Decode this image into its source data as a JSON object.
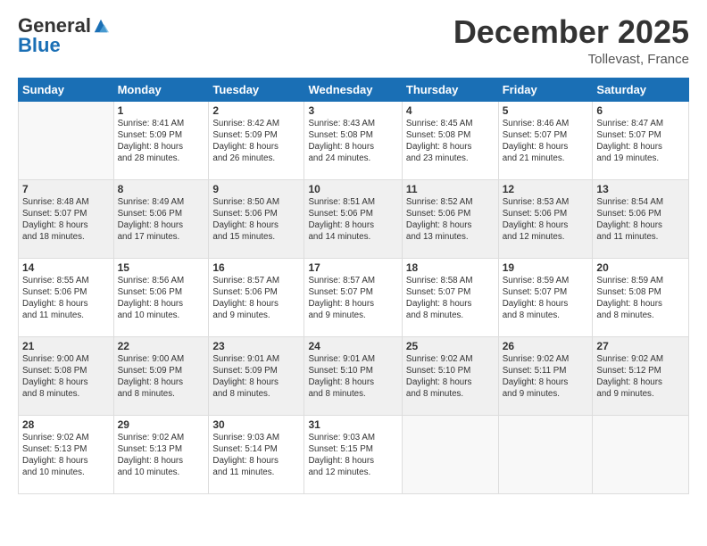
{
  "logo": {
    "general": "General",
    "blue": "Blue"
  },
  "header": {
    "month": "December 2025",
    "location": "Tollevast, France"
  },
  "weekdays": [
    "Sunday",
    "Monday",
    "Tuesday",
    "Wednesday",
    "Thursday",
    "Friday",
    "Saturday"
  ],
  "weeks": [
    [
      {
        "date": "",
        "info": ""
      },
      {
        "date": "1",
        "info": "Sunrise: 8:41 AM\nSunset: 5:09 PM\nDaylight: 8 hours\nand 28 minutes."
      },
      {
        "date": "2",
        "info": "Sunrise: 8:42 AM\nSunset: 5:09 PM\nDaylight: 8 hours\nand 26 minutes."
      },
      {
        "date": "3",
        "info": "Sunrise: 8:43 AM\nSunset: 5:08 PM\nDaylight: 8 hours\nand 24 minutes."
      },
      {
        "date": "4",
        "info": "Sunrise: 8:45 AM\nSunset: 5:08 PM\nDaylight: 8 hours\nand 23 minutes."
      },
      {
        "date": "5",
        "info": "Sunrise: 8:46 AM\nSunset: 5:07 PM\nDaylight: 8 hours\nand 21 minutes."
      },
      {
        "date": "6",
        "info": "Sunrise: 8:47 AM\nSunset: 5:07 PM\nDaylight: 8 hours\nand 19 minutes."
      }
    ],
    [
      {
        "date": "7",
        "info": "Sunrise: 8:48 AM\nSunset: 5:07 PM\nDaylight: 8 hours\nand 18 minutes."
      },
      {
        "date": "8",
        "info": "Sunrise: 8:49 AM\nSunset: 5:06 PM\nDaylight: 8 hours\nand 17 minutes."
      },
      {
        "date": "9",
        "info": "Sunrise: 8:50 AM\nSunset: 5:06 PM\nDaylight: 8 hours\nand 15 minutes."
      },
      {
        "date": "10",
        "info": "Sunrise: 8:51 AM\nSunset: 5:06 PM\nDaylight: 8 hours\nand 14 minutes."
      },
      {
        "date": "11",
        "info": "Sunrise: 8:52 AM\nSunset: 5:06 PM\nDaylight: 8 hours\nand 13 minutes."
      },
      {
        "date": "12",
        "info": "Sunrise: 8:53 AM\nSunset: 5:06 PM\nDaylight: 8 hours\nand 12 minutes."
      },
      {
        "date": "13",
        "info": "Sunrise: 8:54 AM\nSunset: 5:06 PM\nDaylight: 8 hours\nand 11 minutes."
      }
    ],
    [
      {
        "date": "14",
        "info": "Sunrise: 8:55 AM\nSunset: 5:06 PM\nDaylight: 8 hours\nand 11 minutes."
      },
      {
        "date": "15",
        "info": "Sunrise: 8:56 AM\nSunset: 5:06 PM\nDaylight: 8 hours\nand 10 minutes."
      },
      {
        "date": "16",
        "info": "Sunrise: 8:57 AM\nSunset: 5:06 PM\nDaylight: 8 hours\nand 9 minutes."
      },
      {
        "date": "17",
        "info": "Sunrise: 8:57 AM\nSunset: 5:07 PM\nDaylight: 8 hours\nand 9 minutes."
      },
      {
        "date": "18",
        "info": "Sunrise: 8:58 AM\nSunset: 5:07 PM\nDaylight: 8 hours\nand 8 minutes."
      },
      {
        "date": "19",
        "info": "Sunrise: 8:59 AM\nSunset: 5:07 PM\nDaylight: 8 hours\nand 8 minutes."
      },
      {
        "date": "20",
        "info": "Sunrise: 8:59 AM\nSunset: 5:08 PM\nDaylight: 8 hours\nand 8 minutes."
      }
    ],
    [
      {
        "date": "21",
        "info": "Sunrise: 9:00 AM\nSunset: 5:08 PM\nDaylight: 8 hours\nand 8 minutes."
      },
      {
        "date": "22",
        "info": "Sunrise: 9:00 AM\nSunset: 5:09 PM\nDaylight: 8 hours\nand 8 minutes."
      },
      {
        "date": "23",
        "info": "Sunrise: 9:01 AM\nSunset: 5:09 PM\nDaylight: 8 hours\nand 8 minutes."
      },
      {
        "date": "24",
        "info": "Sunrise: 9:01 AM\nSunset: 5:10 PM\nDaylight: 8 hours\nand 8 minutes."
      },
      {
        "date": "25",
        "info": "Sunrise: 9:02 AM\nSunset: 5:10 PM\nDaylight: 8 hours\nand 8 minutes."
      },
      {
        "date": "26",
        "info": "Sunrise: 9:02 AM\nSunset: 5:11 PM\nDaylight: 8 hours\nand 9 minutes."
      },
      {
        "date": "27",
        "info": "Sunrise: 9:02 AM\nSunset: 5:12 PM\nDaylight: 8 hours\nand 9 minutes."
      }
    ],
    [
      {
        "date": "28",
        "info": "Sunrise: 9:02 AM\nSunset: 5:13 PM\nDaylight: 8 hours\nand 10 minutes."
      },
      {
        "date": "29",
        "info": "Sunrise: 9:02 AM\nSunset: 5:13 PM\nDaylight: 8 hours\nand 10 minutes."
      },
      {
        "date": "30",
        "info": "Sunrise: 9:03 AM\nSunset: 5:14 PM\nDaylight: 8 hours\nand 11 minutes."
      },
      {
        "date": "31",
        "info": "Sunrise: 9:03 AM\nSunset: 5:15 PM\nDaylight: 8 hours\nand 12 minutes."
      },
      {
        "date": "",
        "info": ""
      },
      {
        "date": "",
        "info": ""
      },
      {
        "date": "",
        "info": ""
      }
    ]
  ]
}
